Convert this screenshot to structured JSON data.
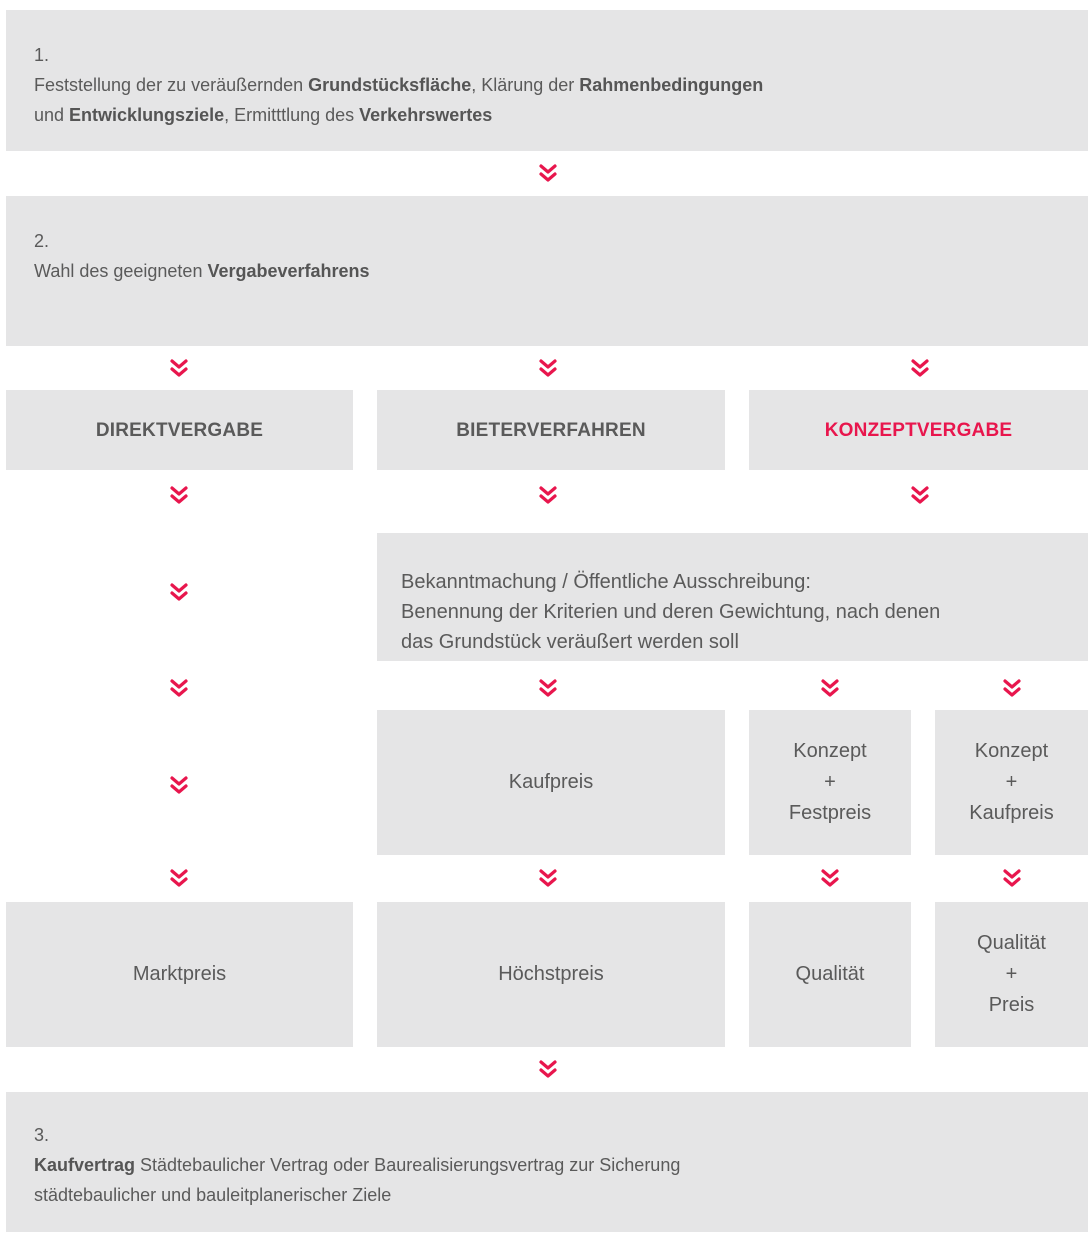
{
  "colors": {
    "box": "#e5e5e6",
    "text": "#5a5a5a",
    "accent": "#e8164d"
  },
  "step1": {
    "num": "1.",
    "line1": [
      "Feststellung der zu veräußernden ",
      "Grundstücksfläche",
      ", Klärung der ",
      "Rahmenbedingungen"
    ],
    "line2": [
      "und ",
      "Entwicklungsziele",
      ", Ermitttlung des ",
      "Verkehrswertes"
    ]
  },
  "step2": {
    "num": "2.",
    "text": "Wahl des geeigneten ",
    "bold": "Vergabeverfahrens"
  },
  "procedures": {
    "direkt": "DIREKTVERGABE",
    "bieter": "BIETERVERFAHREN",
    "konzept": "KONZEPTVERGABE"
  },
  "announcement": {
    "lines": [
      "Bekanntmachung / Öffentliche Ausschreibung:",
      "Benennung der Kriterien und deren Gewichtung, nach denen",
      "das Grundstück veräußert werden soll"
    ]
  },
  "criteria": {
    "kaufpreis": "Kaufpreis",
    "konzept_festpreis": [
      "Konzept",
      "+",
      "Festpreis"
    ],
    "konzept_kaufpreis": [
      "Konzept",
      "+",
      "Kaufpreis"
    ]
  },
  "results": {
    "marktpreis": "Marktpreis",
    "hoechstpreis": "Höchstpreis",
    "qualitaet": "Qualität",
    "qualitaet_preis": [
      "Qualität",
      "+",
      "Preis"
    ]
  },
  "step3": {
    "num": "3.",
    "bold": "Kaufvertrag",
    "line1": " Städtebaulicher Vertrag oder Baurealisierungsvertrag zur Sicherung",
    "line2": "städtebaulicher und bauleitplanerischer Ziele"
  }
}
